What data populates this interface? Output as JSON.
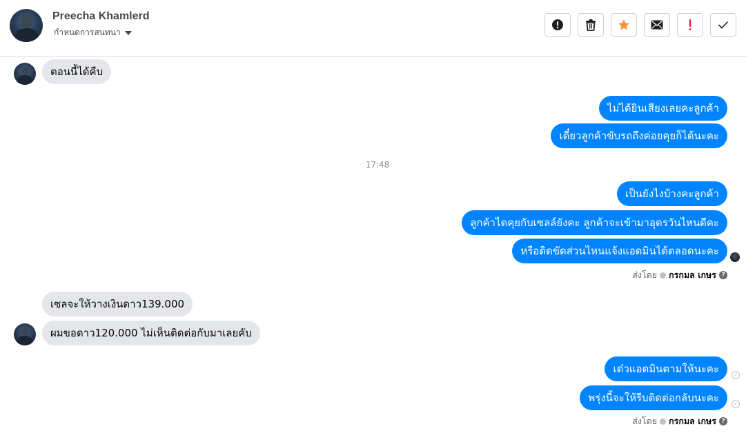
{
  "header": {
    "contact_name": "Preecha Khamlerd",
    "subtitle": "กำหนดการสนทนา",
    "actions": [
      {
        "name": "report-button",
        "icon": "alert-circle-icon"
      },
      {
        "name": "delete-button",
        "icon": "trash-icon"
      },
      {
        "name": "star-button",
        "icon": "star-icon",
        "color": "#f7923b"
      },
      {
        "name": "mark-unread-button",
        "icon": "envelope-icon"
      },
      {
        "name": "important-button",
        "icon": "exclamation-icon",
        "color": "#e41e3f"
      },
      {
        "name": "done-button",
        "icon": "checkmark-icon"
      }
    ]
  },
  "messages": {
    "m1": "ตอนนี้ได้คืบ",
    "m2": "ไม่ได้ยินเสียงเลยคะลูกค้า",
    "m3": "เดี๋ยวลูกค้าขับรถถึงค่อยคุยก็ได้นะคะ",
    "timestamp": "17:48",
    "m4": "เป็นยังไงบ้างคะลูกค้า",
    "m5": "ลูกค้าไดคุยกับเซลล์ยังคะ ลูกค้าจะเข้ามาอุดรวันไหนดีคะ",
    "m6": "หรือติดขัดส่วนไหนแจ้งแอดมินได้ตลอดนะคะ",
    "sent_by_label": "ส่งโดย",
    "sent_by_name": "กรกมล เกษร",
    "m7": "เซลจะให้วางเงินดาว139.000",
    "m8": "ผมขอดาว120.000 ไม่เห็นติดต่อกับมาเลยคับ",
    "m9": "เด๋วแอดมินตามให้นะคะ",
    "m10": "พรุ่งนี้จะให้รีบติดต่อกลับนะคะ"
  },
  "colors": {
    "outgoing_bubble": "#0084ff",
    "incoming_bubble": "#e4e6eb"
  }
}
